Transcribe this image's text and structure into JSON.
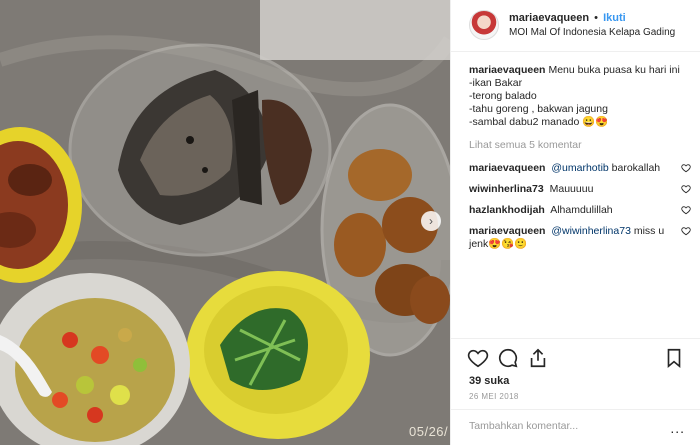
{
  "photo": {
    "date_stamp": "05/26/",
    "next_icon": "chevron-right-icon"
  },
  "header": {
    "username": "mariaevaqueen",
    "separator": "•",
    "follow_label": "Ikuti",
    "location": "MOI Mal Of Indonesia Kelapa Gading"
  },
  "caption": {
    "username": "mariaevaqueen",
    "line1": "Menu buka puasa ku hari ini",
    "line2": "-ikan Bakar",
    "line3": "-terong balado",
    "line4": "-tahu goreng , bakwan jagung",
    "line5": "-sambal dabu2 manado 😀😍"
  },
  "view_all": "Lihat semua 5 komentar",
  "comments": [
    {
      "username": "mariaevaqueen",
      "mention": "@umarhotib",
      "text": "barokallah"
    },
    {
      "username": "wiwinherlina73",
      "mention": "",
      "text": "Mauuuuu"
    },
    {
      "username": "hazlankhodijah",
      "mention": "",
      "text": "Alhamdulillah"
    },
    {
      "username": "mariaevaqueen",
      "mention": "@wiwinherlina73",
      "text": "miss u jenk😍😘🙂"
    }
  ],
  "likes": "39 suka",
  "date": "26 MEI 2018",
  "add_comment": {
    "placeholder": "Tambahkan komentar...",
    "more_label": "..."
  },
  "colors": {
    "link": "#3897f0",
    "mention": "#003569",
    "muted": "#999999"
  },
  "icons": [
    "heart-icon",
    "comment-icon",
    "share-icon",
    "bookmark-icon"
  ]
}
